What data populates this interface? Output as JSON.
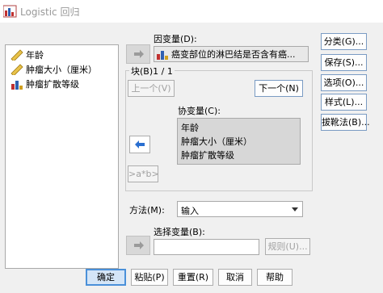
{
  "window": {
    "title": "Logistic 回归"
  },
  "variables": [
    {
      "label": "年龄",
      "icon": "ruler-icon"
    },
    {
      "label": "肿瘤大小（厘米）",
      "icon": "ruler-icon"
    },
    {
      "label": "肿瘤扩散等级",
      "icon": "bar-chart-icon"
    }
  ],
  "dependent": {
    "label": "因变量(D):",
    "value": "癌变部位的淋巴结是否含有癌..."
  },
  "block": {
    "label": "块(B)1 / 1",
    "prev_label": "上一个(V)",
    "next_label": "下一个(N)"
  },
  "covariates": {
    "label": "协变量(C):",
    "items": [
      "年龄",
      "肿瘤大小（厘米）",
      "肿瘤扩散等级"
    ],
    "interaction_label": ">a*b>"
  },
  "method": {
    "label": "方法(M):",
    "value": "输入"
  },
  "selection": {
    "label": "选择变量(B):",
    "value": "",
    "rule_label": "规则(U)..."
  },
  "side_buttons": [
    "分类(G)...",
    "保存(S)...",
    "选项(O)...",
    "样式(L)...",
    "拔靴法(B)..."
  ],
  "footer_buttons": [
    "确定",
    "粘贴(P)",
    "重置(R)",
    "取消",
    "帮助"
  ],
  "colors": {
    "accent": "#4a90d9",
    "ok_button": "#d4e5f7"
  }
}
